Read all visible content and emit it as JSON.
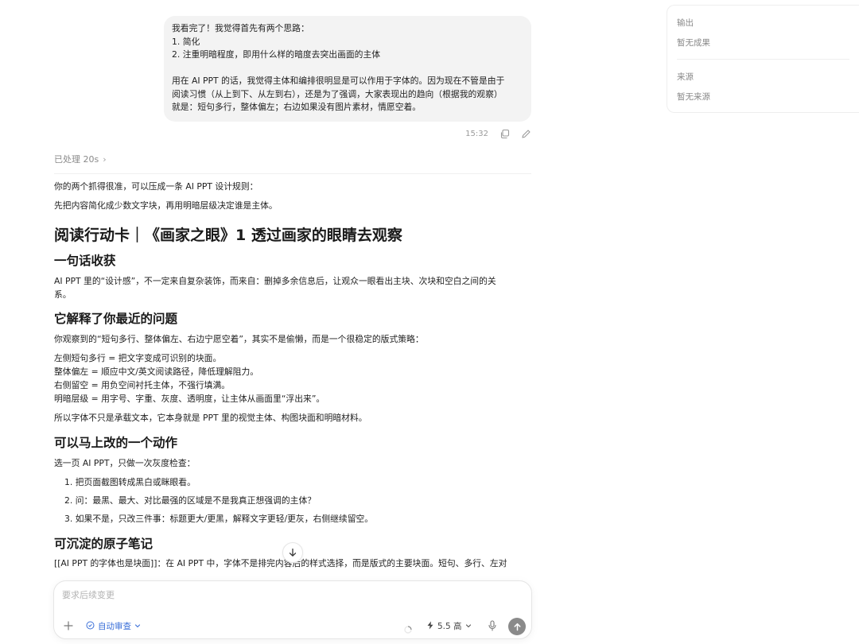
{
  "user_message": {
    "lines": [
      "我看完了！我觉得首先有两个思路：",
      "1. 简化",
      "2. 注重明暗程度，即用什么样的暗度去突出画面的主体",
      "",
      "用在 AI PPT 的话，我觉得主体和编排很明显是可以作用于字体的。因为现在不管是由于",
      "阅读习惯（从上到下、从左到右），还是为了强调，大家表现出的趋向（根据我的观察）",
      "就是：短句多行，整体偏左；右边如果没有图片素材，情愿空着。"
    ],
    "time": "15:32",
    "copy_icon": "copy-icon",
    "edit_icon": "pencil-icon"
  },
  "processed": {
    "label": "已处理 20s",
    "icon": "chevron-right-icon"
  },
  "response": {
    "intro1": "你的两个抓得很准，可以压成一条 AI PPT 设计规则：",
    "intro2": "先把内容简化成少数文字块，再用明暗层级决定谁是主体。",
    "title": "阅读行动卡｜《画家之眼》1 透过画家的眼睛去观察",
    "s1": {
      "heading": "一句话收获",
      "line1": "AI PPT 里的“设计感”，不一定来自复杂装饰，而来自：删掉多余信息后，让观众一眼看出主块、次块和空白之间的关",
      "line2": "系。"
    },
    "s2": {
      "heading": "它解释了你最近的问题",
      "intro": "你观察到的“短句多行、整体偏左、右边宁愿空着”，其实不是偷懒，而是一个很稳定的版式策略：",
      "items": [
        "左侧短句多行 = 把文字变成可识别的块面。",
        "整体偏左 = 顺应中文/英文阅读路径，降低理解阻力。",
        "右侧留空 = 用负空间衬托主体，不强行填满。",
        "明暗层级 = 用字号、字重、灰度、透明度，让主体从画面里“浮出来”。"
      ],
      "outro": "所以字体不只是承载文本，它本身就是 PPT 里的视觉主体、构图块面和明暗材料。"
    },
    "s3": {
      "heading": "可以马上改的一个动作",
      "intro": "选一页 AI PPT，只做一次灰度检查：",
      "items": [
        "1. 把页面截图转成黑白或眯眼看。",
        "2. 问：最黑、最大、对比最强的区域是不是我真正想强调的主体？",
        "3. 如果不是，只改三件事：标题更大/更黑，解释文字更轻/更灰，右侧继续留空。"
      ]
    },
    "s4": {
      "heading": "可沉淀的原子笔记",
      "partial": "[[AI PPT 的字体也是块面]]：在 AI PPT 中，字体不是排完内容后的样式选择，而是版式的主要块面。短句、多行、左对"
    }
  },
  "scroll_button": {
    "icon": "arrow-down-icon"
  },
  "composer": {
    "placeholder": "要求后续变更",
    "plus_icon": "plus-icon",
    "review_icon": "shield-icon",
    "review_label": "自动审查",
    "model_icon": "lightning-icon",
    "model_label": "5.5 高",
    "mic_icon": "microphone-icon",
    "send_icon": "arrow-up-icon"
  },
  "side_panel": {
    "output_label": "输出",
    "output_value": "暂无成果",
    "source_label": "来源",
    "source_value": "暂无来源"
  }
}
